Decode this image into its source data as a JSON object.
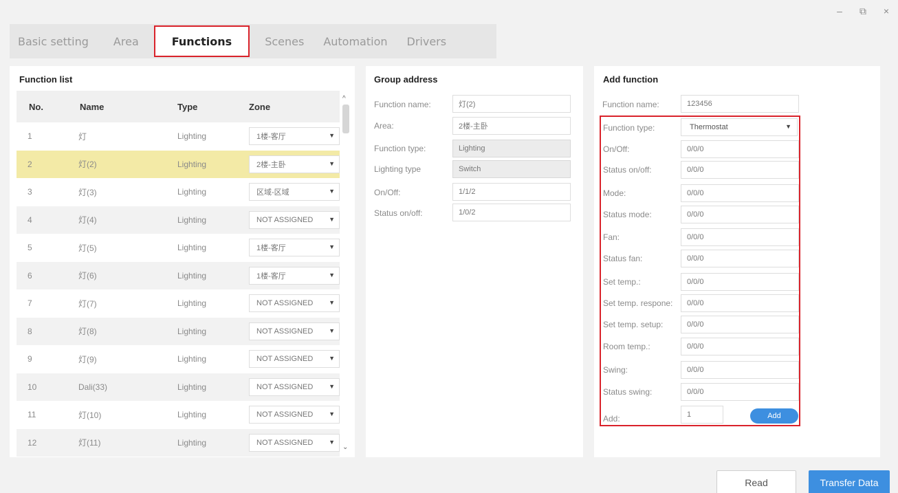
{
  "window": {
    "minimize": "–",
    "restore": "⧉",
    "close": "×"
  },
  "tabs": [
    "Basic setting",
    "Area",
    "Functions",
    "Scenes",
    "Automation",
    "Drivers"
  ],
  "function_list": {
    "title": "Function list",
    "headers": {
      "no": "No.",
      "name": "Name",
      "type": "Type",
      "zone": "Zone"
    },
    "rows": [
      {
        "no": "1",
        "name": "灯",
        "type": "Lighting",
        "zone": "1楼-客厅"
      },
      {
        "no": "2",
        "name": "灯(2)",
        "type": "Lighting",
        "zone": "2楼-主卧"
      },
      {
        "no": "3",
        "name": "灯(3)",
        "type": "Lighting",
        "zone": "区域-区域"
      },
      {
        "no": "4",
        "name": "灯(4)",
        "type": "Lighting",
        "zone": "NOT ASSIGNED"
      },
      {
        "no": "5",
        "name": "灯(5)",
        "type": "Lighting",
        "zone": "1楼-客厅"
      },
      {
        "no": "6",
        "name": "灯(6)",
        "type": "Lighting",
        "zone": "1楼-客厅"
      },
      {
        "no": "7",
        "name": "灯(7)",
        "type": "Lighting",
        "zone": "NOT ASSIGNED"
      },
      {
        "no": "8",
        "name": "灯(8)",
        "type": "Lighting",
        "zone": "NOT ASSIGNED"
      },
      {
        "no": "9",
        "name": "灯(9)",
        "type": "Lighting",
        "zone": "NOT ASSIGNED"
      },
      {
        "no": "10",
        "name": "Dali(33)",
        "type": "Lighting",
        "zone": "NOT ASSIGNED"
      },
      {
        "no": "11",
        "name": "灯(10)",
        "type": "Lighting",
        "zone": "NOT ASSIGNED"
      },
      {
        "no": "12",
        "name": "灯(11)",
        "type": "Lighting",
        "zone": "NOT ASSIGNED"
      }
    ]
  },
  "group_address": {
    "title": "Group address",
    "function_name_label": "Function name:",
    "function_name": "灯(2)",
    "area_label": "Area:",
    "area": "2楼-主卧",
    "function_type_label": "Function type:",
    "function_type": "Lighting",
    "lighting_type_label": "Lighting type",
    "lighting_type": "Switch",
    "onoff_label": "On/Off:",
    "onoff": "1/1/2",
    "status_onoff_label": "Status on/off:",
    "status_onoff": "1/0/2"
  },
  "add_function": {
    "title": "Add function",
    "function_name_label": "Function name:",
    "function_name": "123456",
    "function_type_label": "Function type:",
    "function_type": "Thermostat",
    "fields": [
      {
        "label": "On/Off:",
        "value": "0/0/0"
      },
      {
        "label": "Status on/off:",
        "value": "0/0/0"
      },
      {
        "label": "Mode:",
        "value": "0/0/0"
      },
      {
        "label": "Status mode:",
        "value": "0/0/0"
      },
      {
        "label": "Fan:",
        "value": "0/0/0"
      },
      {
        "label": "Status fan:",
        "value": "0/0/0"
      },
      {
        "label": "Set temp.:",
        "value": "0/0/0"
      },
      {
        "label": "Set temp. respone:",
        "value": "0/0/0"
      },
      {
        "label": "Set temp. setup:",
        "value": "0/0/0"
      },
      {
        "label": "Room temp.:",
        "value": "0/0/0"
      },
      {
        "label": "Swing:",
        "value": "0/0/0"
      },
      {
        "label": "Status swing:",
        "value": "0/0/0"
      }
    ],
    "add_label": "Add:",
    "add_count": "1",
    "add_button": "Add"
  },
  "buttons": {
    "read": "Read",
    "transfer": "Transfer Data"
  },
  "colors": {
    "accent": "#3d8fe0",
    "highlight": "#d9222a",
    "selected_row": "#f3eaa6"
  }
}
